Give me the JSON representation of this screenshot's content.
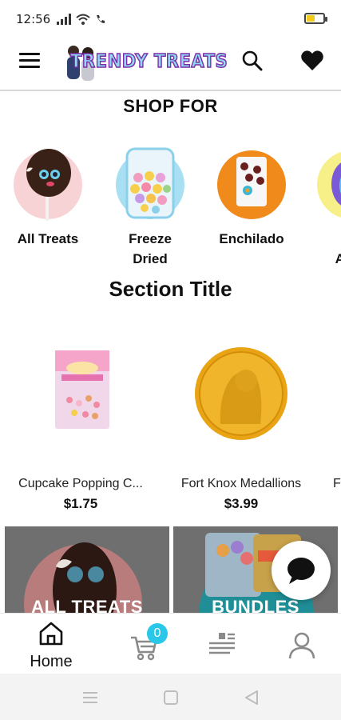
{
  "status_bar": {
    "time": "12:56"
  },
  "header": {
    "logo_text": "TRENDY TREATS"
  },
  "shop_for": {
    "title": "SHOP FOR"
  },
  "categories": [
    {
      "label": "All  Treats"
    },
    {
      "label": "Freeze\nDried"
    },
    {
      "label": "Enchilado"
    },
    {
      "label": "To\nAcce"
    }
  ],
  "section": {
    "title": "Section Title"
  },
  "products": [
    {
      "name": "Cupcake Popping C...",
      "price": "$1.75"
    },
    {
      "name": "Fort Knox Medallions",
      "price": "$3.99"
    },
    {
      "name": "F"
    }
  ],
  "banners": [
    {
      "label": "ALL TREATS"
    },
    {
      "label": "BUNDLES"
    }
  ],
  "bottom_nav": {
    "home_label": "Home",
    "cart_count": "0"
  },
  "colors": {
    "accent": "#29c7e8",
    "logo_fill": "#8fd9f2",
    "logo_stroke": "#7a2ea8",
    "battery": "#f2cc1b"
  }
}
